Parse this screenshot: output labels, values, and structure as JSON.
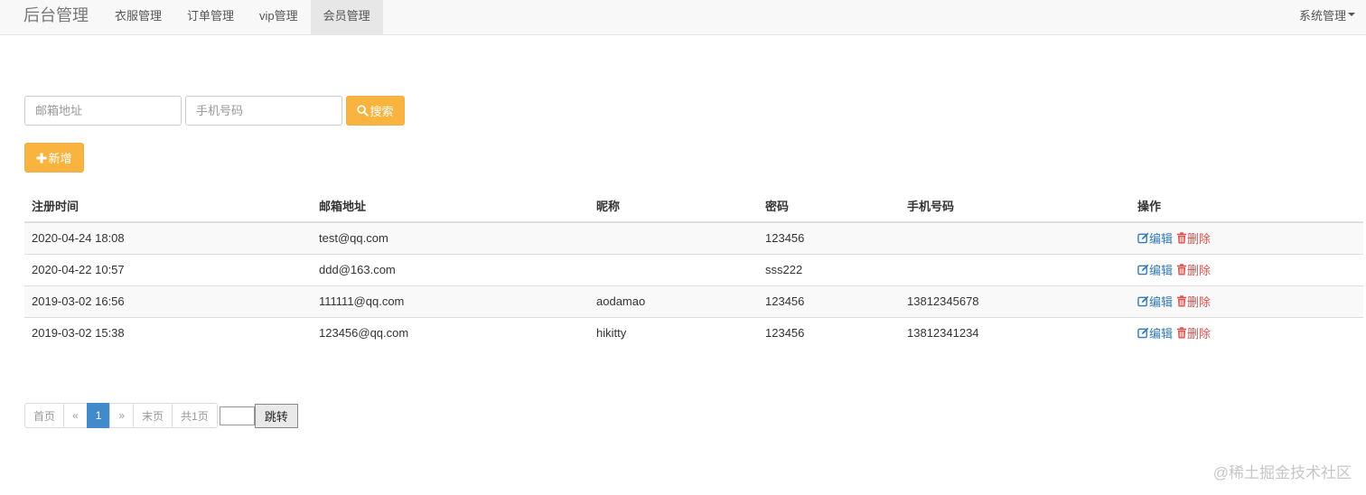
{
  "navbar": {
    "brand": "后台管理",
    "items": [
      {
        "label": "衣服管理"
      },
      {
        "label": "订单管理"
      },
      {
        "label": "vip管理"
      },
      {
        "label": "会员管理"
      }
    ],
    "right_menu": "系统管理"
  },
  "search": {
    "email_placeholder": "邮箱地址",
    "phone_placeholder": "手机号码",
    "button_label": "搜索"
  },
  "add_button_label": "新增",
  "table": {
    "headers": [
      "注册时间",
      "邮箱地址",
      "昵称",
      "密码",
      "手机号码",
      "操作"
    ],
    "rows": [
      {
        "time": "2020-04-24 18:08",
        "email": "test@qq.com",
        "nick": "",
        "password": "123456",
        "phone": ""
      },
      {
        "time": "2020-04-22 10:57",
        "email": "ddd@163.com",
        "nick": "",
        "password": "sss222",
        "phone": ""
      },
      {
        "time": "2019-03-02 16:56",
        "email": "111111@qq.com",
        "nick": "aodamao",
        "password": "123456",
        "phone": "13812345678"
      },
      {
        "time": "2019-03-02 15:38",
        "email": "123456@qq.com",
        "nick": "hikitty",
        "password": "123456",
        "phone": "13812341234"
      }
    ],
    "edit_label": "编辑",
    "delete_label": "删除"
  },
  "pagination": {
    "first": "首页",
    "prev": "«",
    "current": "1",
    "next": "»",
    "last": "末页",
    "total": "共1页",
    "jump_label": "跳转"
  },
  "watermark": "@稀土掘金技术社区",
  "colors": {
    "warning": "#f8b43e",
    "primary": "#428bca",
    "edit_link": "#337ab7",
    "delete_link": "#d9534f"
  }
}
